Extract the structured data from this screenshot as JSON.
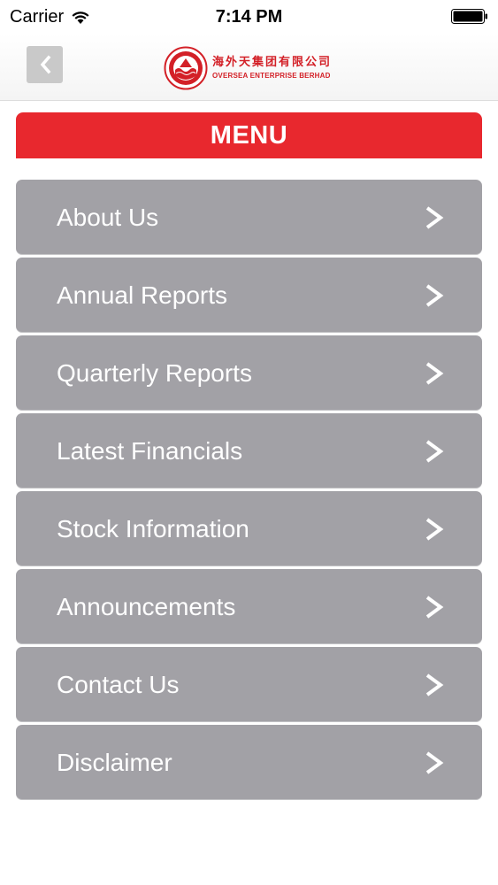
{
  "status_bar": {
    "carrier": "Carrier",
    "time": "7:14 PM"
  },
  "nav": {
    "back_icon": "chevron-left-icon",
    "logo": {
      "chinese": "海外天集团有限公司",
      "english": "OVERSEA ENTERPRISE BERHAD"
    }
  },
  "menu": {
    "title": "MENU",
    "header_color": "#e8282e",
    "item_color": "#a2a1a6",
    "items": [
      {
        "label": "About Us"
      },
      {
        "label": "Annual Reports"
      },
      {
        "label": "Quarterly Reports"
      },
      {
        "label": "Latest Financials"
      },
      {
        "label": "Stock Information"
      },
      {
        "label": "Announcements"
      },
      {
        "label": "Contact Us"
      },
      {
        "label": "Disclaimer"
      }
    ]
  }
}
